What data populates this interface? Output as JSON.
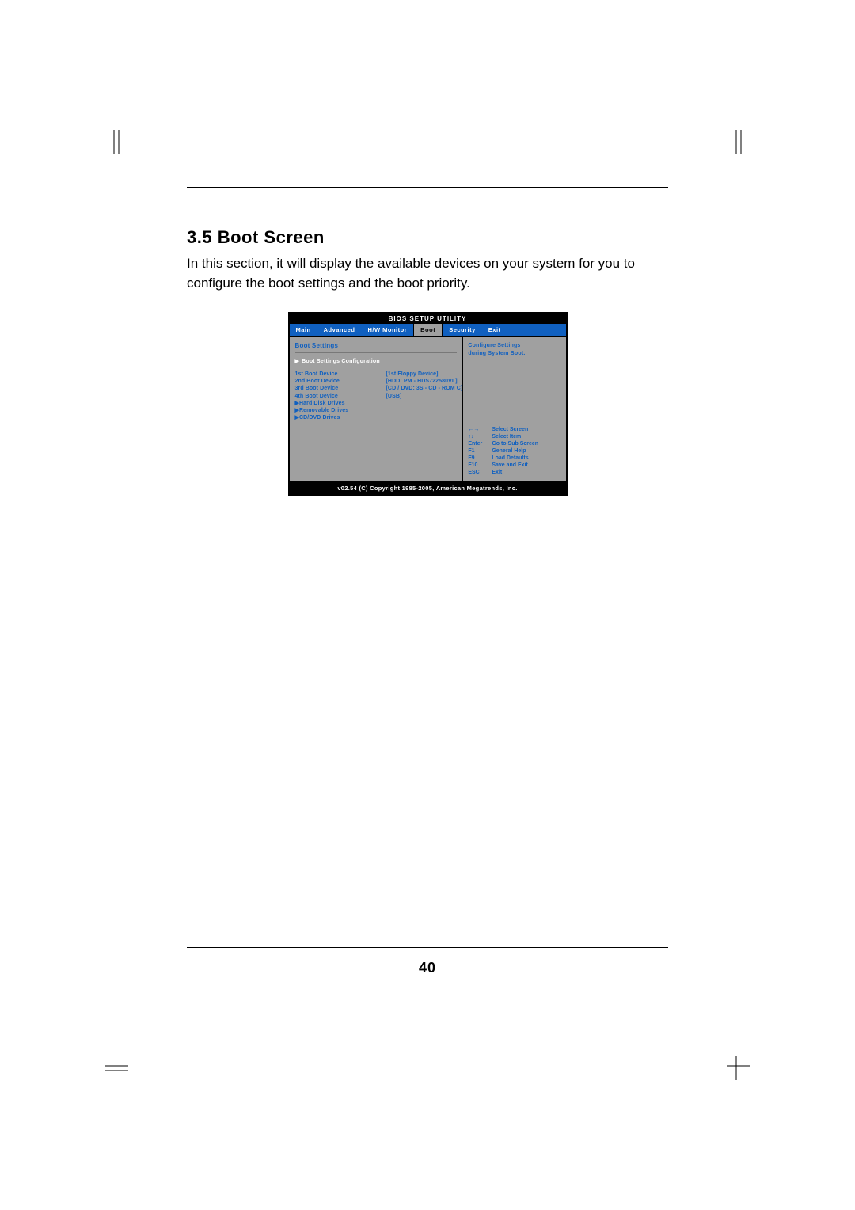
{
  "section_number": "3.5",
  "section_title": "Boot Screen",
  "body_paragraph": "In this section, it will display the available devices on your system for you to configure the boot settings and the boot priority.",
  "page_number": "40",
  "bios": {
    "title": "BIOS SETUP UTILITY",
    "tabs": {
      "main": "Main",
      "advanced": "Advanced",
      "hw": "H/W Monitor",
      "boot": "Boot",
      "security": "Security",
      "exit": "Exit"
    },
    "left": {
      "heading": "Boot Settings",
      "subheading": "Boot Settings Configuration",
      "rows": [
        {
          "label": "1st Boot Device",
          "value": "[1st  Floppy Device]"
        },
        {
          "label": "2nd Boot Device",
          "value": "[HDD: PM - HDS722580VL]"
        },
        {
          "label": "3rd Boot Device",
          "value": "[CD / DVD: 3S - CD - ROM C]"
        },
        {
          "label": "4th Boot Device",
          "value": "[USB]"
        }
      ],
      "extras": [
        "Hard Disk Drives",
        "Removable Drives",
        "CD/DVD Drives"
      ]
    },
    "right": {
      "help_line1": "Configure Settings",
      "help_line2": "during System Boot.",
      "keys": [
        {
          "k": "←→",
          "d": "Select Screen"
        },
        {
          "k": "↑↓",
          "d": "Select Item"
        },
        {
          "k": "Enter",
          "d": "Go to Sub Screen"
        },
        {
          "k": "F1",
          "d": "General Help"
        },
        {
          "k": "F9",
          "d": "Load Defaults"
        },
        {
          "k": "F10",
          "d": "Save and Exit"
        },
        {
          "k": "ESC",
          "d": "Exit"
        }
      ]
    },
    "footer": "v02.54 (C) Copyright 1985-2005, American Megatrends, Inc."
  }
}
